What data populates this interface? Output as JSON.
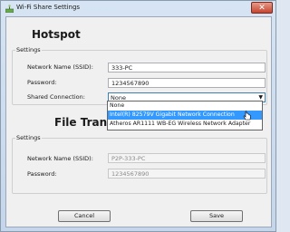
{
  "window": {
    "title": "Wi-Fi Share Settings",
    "close_glyph": "✕"
  },
  "hotspot": {
    "heading": "Hotspot",
    "group_title": "Settings",
    "ssid_label": "Network Name (SSID):",
    "ssid_value": "333-PC",
    "password_label": "Password:",
    "password_value": "1234567890",
    "shared_label": "Shared Connection:",
    "shared_value": "None",
    "shared_options": [
      "None",
      "Intel(R) 82579V Gigabit Network Connection",
      "Atheros AR1111 WB-EG Wireless Network Adapter"
    ],
    "highlighted_option": 1
  },
  "file_transfer": {
    "heading": "File Transfer",
    "group_title": "Settings",
    "ssid_label": "Network Name (SSID):",
    "ssid_value": "P2P-333-PC",
    "password_label": "Password:",
    "password_value": "1234567890"
  },
  "buttons": {
    "cancel": "Cancel",
    "save": "Save"
  },
  "colors": {
    "highlight": "#3399ff",
    "window_frame": "#c5d6ea",
    "close": "#c6452f"
  }
}
